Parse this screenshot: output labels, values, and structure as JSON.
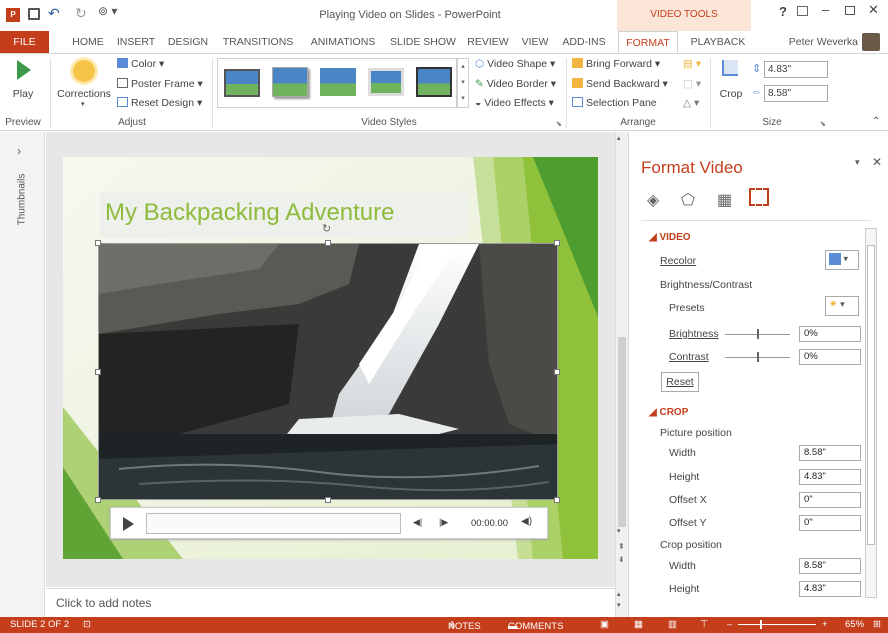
{
  "window": {
    "title": "Playing Video on Slides - PowerPoint",
    "context_label": "VIDEO TOOLS",
    "user": "Peter Weverka"
  },
  "tabs": [
    "FILE",
    "HOME",
    "INSERT",
    "DESIGN",
    "TRANSITIONS",
    "ANIMATIONS",
    "SLIDE SHOW",
    "REVIEW",
    "VIEW",
    "ADD-INS",
    "FORMAT",
    "PLAYBACK"
  ],
  "active_tab": "FORMAT",
  "ribbon": {
    "preview": {
      "play_label": "Play",
      "group": "Preview"
    },
    "adjust": {
      "corrections": "Corrections",
      "color": "Color",
      "poster_frame": "Poster Frame",
      "reset_design": "Reset Design",
      "group": "Adjust"
    },
    "video_styles": {
      "shape": "Video Shape",
      "border": "Video Border",
      "effects": "Video Effects",
      "group": "Video Styles"
    },
    "arrange": {
      "bring_forward": "Bring Forward",
      "send_backward": "Send Backward",
      "selection_pane": "Selection Pane",
      "group": "Arrange"
    },
    "size": {
      "crop": "Crop",
      "height": "4.83\"",
      "width": "8.58\"",
      "group": "Size"
    }
  },
  "thumbnails_label": "Thumbnails",
  "slide": {
    "title": "My Backpacking Adventure",
    "player_time": "00:00.00"
  },
  "notes_placeholder": "Click to add notes",
  "pane": {
    "title": "Format Video",
    "video_section": "VIDEO",
    "recolor": "Recolor",
    "brightness_contrast": "Brightness/Contrast",
    "presets": "Presets",
    "brightness": "Brightness",
    "brightness_value": "0%",
    "contrast": "Contrast",
    "contrast_value": "0%",
    "reset": "Reset",
    "crop_section": "CROP",
    "picture_position": "Picture position",
    "pic_width_label": "Width",
    "pic_width": "8.58\"",
    "pic_height_label": "Height",
    "pic_height": "4.83\"",
    "offset_x_label": "Offset X",
    "offset_x": "0\"",
    "offset_y_label": "Offset Y",
    "offset_y": "0\"",
    "crop_position": "Crop position",
    "crop_width_label": "Width",
    "crop_width": "8.58\"",
    "crop_height_label": "Height",
    "crop_height": "4.83\""
  },
  "status": {
    "slide": "SLIDE 2 OF 2",
    "notes": "NOTES",
    "comments": "COMMENTS",
    "zoom": "65%"
  }
}
